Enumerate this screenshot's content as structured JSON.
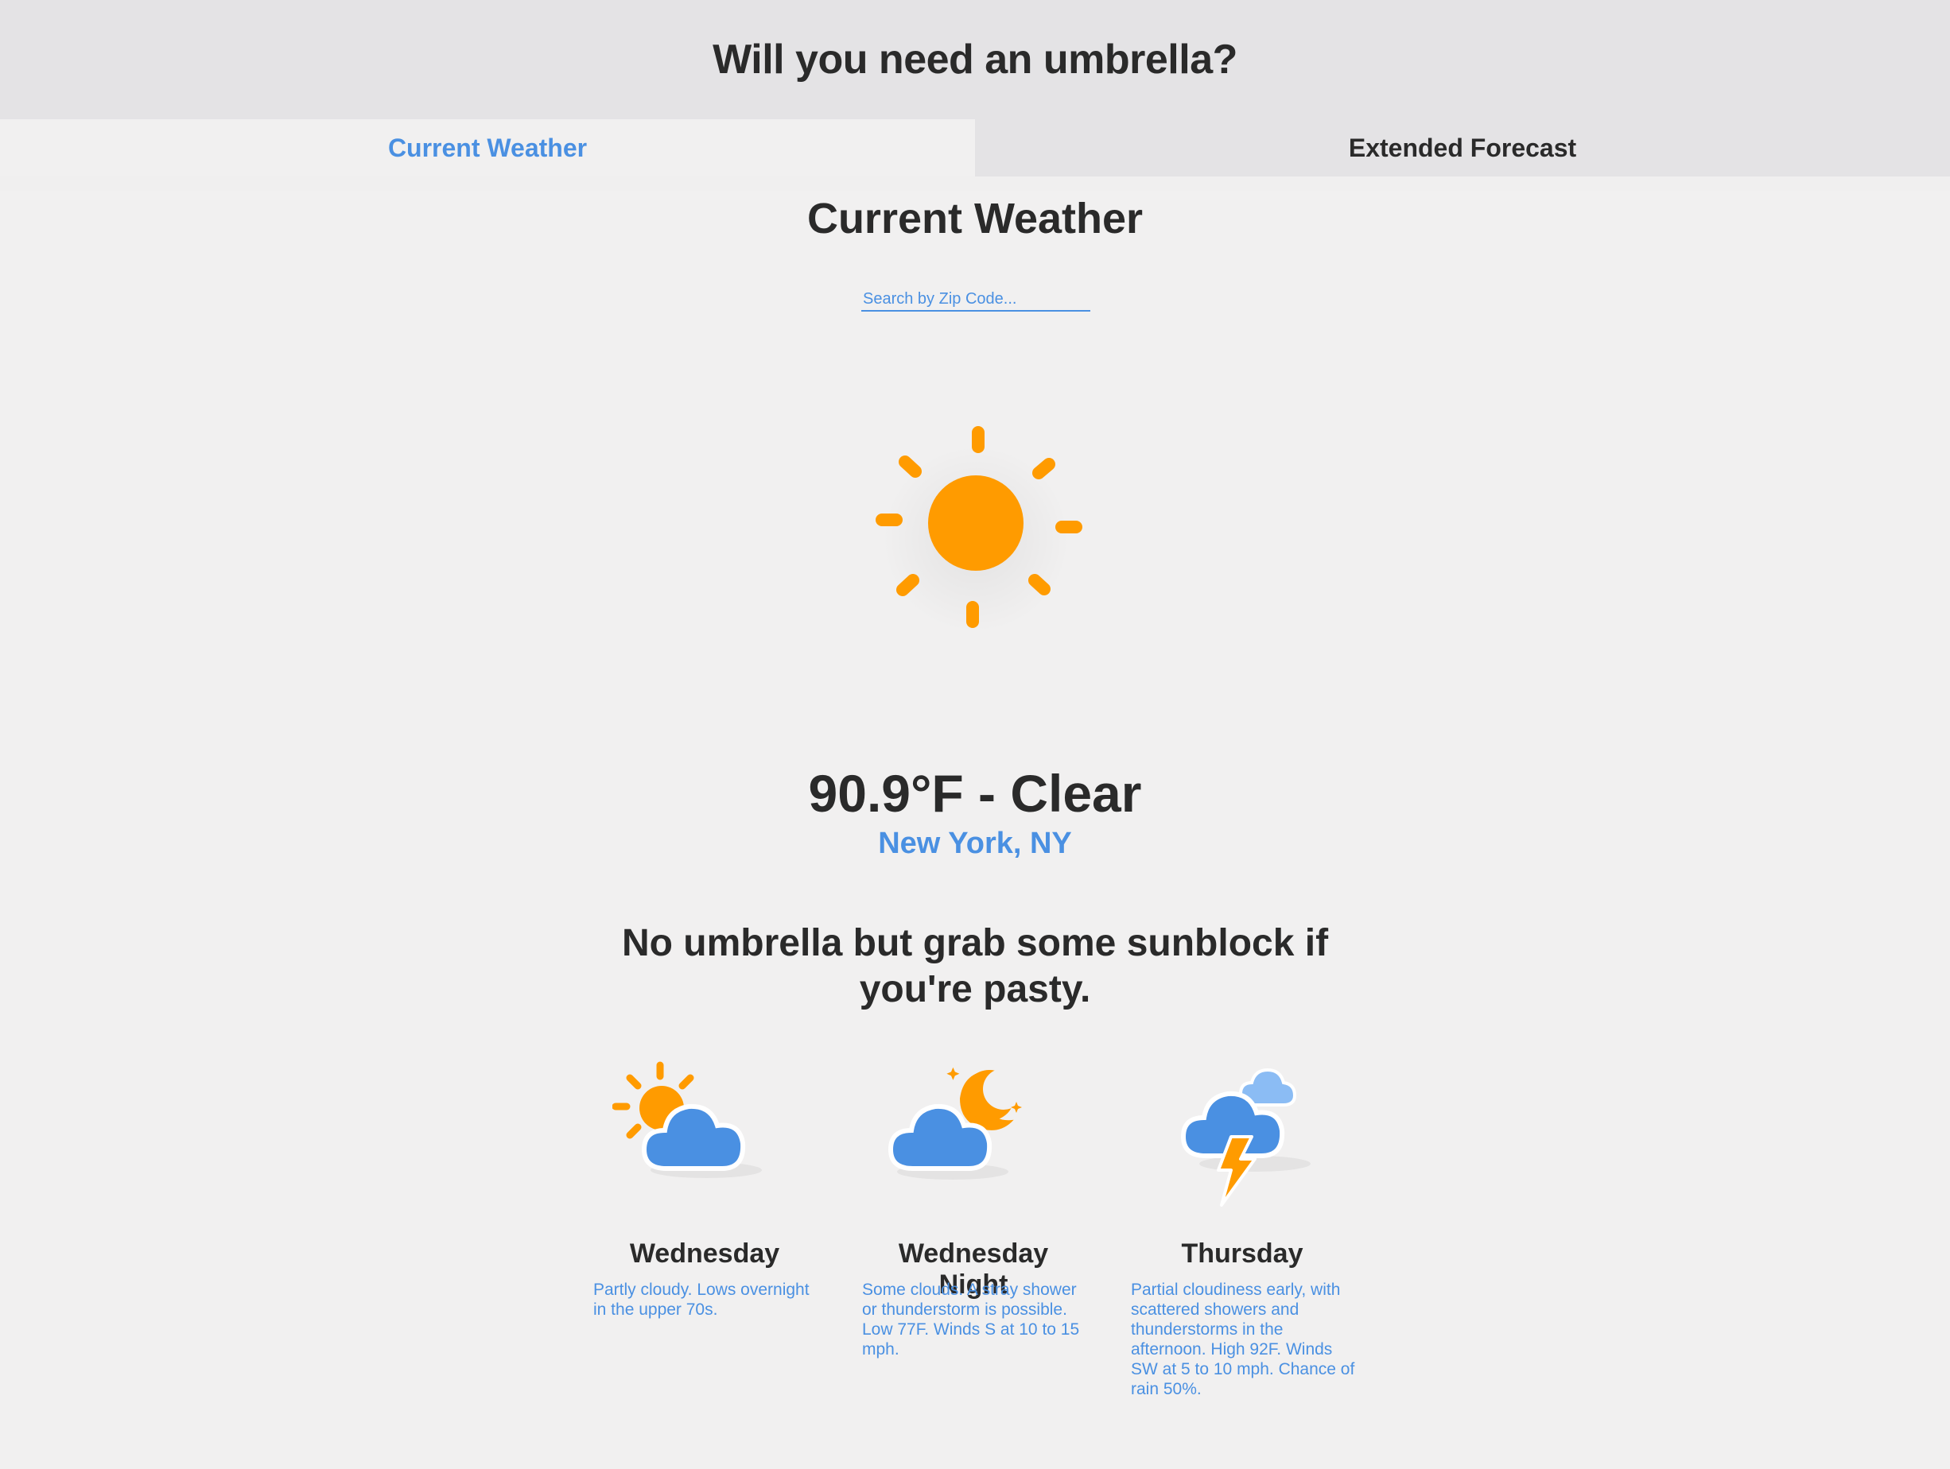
{
  "header": {
    "title": "Will you need an umbrella?"
  },
  "tabs": [
    {
      "label": "Current Weather",
      "active": true
    },
    {
      "label": "Extended Forecast",
      "active": false
    }
  ],
  "current": {
    "section_title": "Current Weather",
    "search_placeholder": "Search by Zip Code...",
    "icon": "sun-icon",
    "temperature_line": "90.9°F - Clear",
    "location": "New York, NY",
    "advice": "No umbrella but grab some sunblock if you're pasty."
  },
  "forecast": [
    {
      "day": "Wednesday",
      "icon": "partly-cloudy-day-icon",
      "description": "Partly cloudy. Lows overnight in the upper 70s."
    },
    {
      "day": "Wednesday Night",
      "icon": "partly-cloudy-night-icon",
      "description": "Some clouds. A stray shower or thunderstorm is possible. Low 77F. Winds S at 10 to 15 mph."
    },
    {
      "day": "Thursday",
      "icon": "thunderstorm-icon",
      "description": "Partial cloudiness early, with scattered showers and thunderstorms in the afternoon. High 92F. Winds SW at 5 to 10 mph. Chance of rain 50%."
    }
  ],
  "colors": {
    "accent": "#4a90e2",
    "sun": "#ff9b00",
    "cloud": "#4a90e2",
    "header_bg": "#e4e3e5",
    "page_bg": "#f1f0f0",
    "text": "#2a2a2a"
  }
}
